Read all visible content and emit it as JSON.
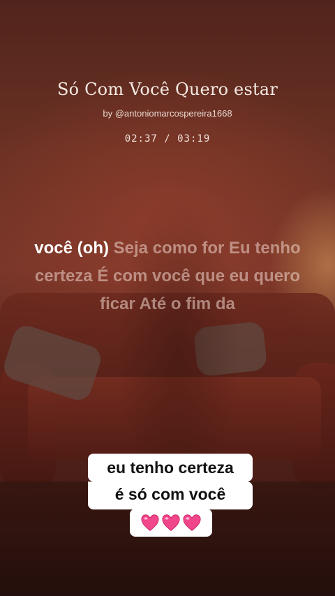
{
  "song": {
    "title": "Só Com Você Quero estar",
    "byline": "by @antoniomarcospereira1668",
    "time": "02:37 / 03:19"
  },
  "lyrics": {
    "active": "você (oh)",
    "rest": " Seja como for Eu tenho certeza É com você que eu quero ficar Até o fim da"
  },
  "caption": {
    "line1": "eu tenho certeza",
    "line2": "é só com você",
    "hearts": [
      "heart-emoji",
      "heart-emoji",
      "heart-emoji"
    ]
  },
  "colors": {
    "heart": "#f0468a",
    "caption_bg": "#ffffff"
  }
}
